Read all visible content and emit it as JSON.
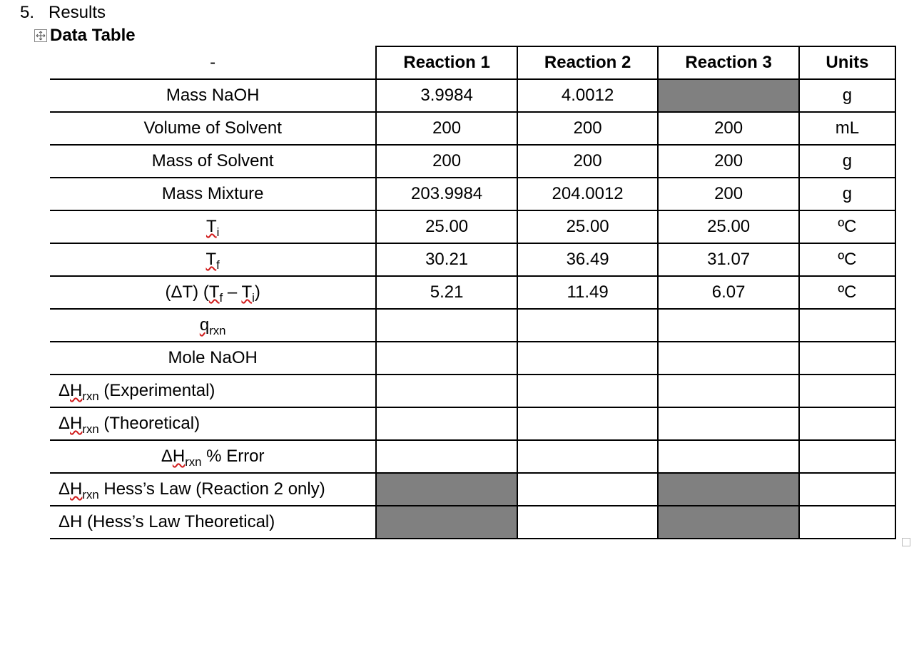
{
  "heading": {
    "list_number": "5.",
    "title": "Results",
    "subtitle": "Data Table"
  },
  "table": {
    "header": {
      "blank": "-",
      "c1": "Reaction 1",
      "c2": "Reaction 2",
      "c3": "Reaction 3",
      "units": "Units"
    },
    "rows": [
      {
        "label_html": "Mass NaOH",
        "align": "center",
        "r1": "3.9984",
        "r2": "4.0012",
        "r3": "",
        "r3_shaded": true,
        "units": "g"
      },
      {
        "label_html": "Volume of Solvent",
        "align": "center",
        "r1": "200",
        "r2": "200",
        "r3": "200",
        "units": "mL"
      },
      {
        "label_html": "Mass of Solvent",
        "align": "center",
        "r1": "200",
        "r2": "200",
        "r3": "200",
        "units": "g"
      },
      {
        "label_html": "Mass Mixture",
        "align": "center",
        "r1": "203.9984",
        "r2": "204.0012",
        "r3": "200",
        "units": "g"
      },
      {
        "label_html": "<span class=\"squiggle\">T<sub>i</sub></span>",
        "align": "center",
        "r1": "25.00",
        "r2": "25.00",
        "r3": "25.00",
        "units": "ºC"
      },
      {
        "label_html": "<span class=\"squiggle\">T<sub>f</sub></span>",
        "align": "center",
        "r1": "30.21",
        "r2": "36.49",
        "r3": "31.07",
        "units": "ºC"
      },
      {
        "label_html": "(ΔT) (<span class=\"squiggle\">T<sub>f</sub></span> – <span class=\"squiggle\">T<sub>i</sub></span>)",
        "align": "center",
        "r1": "5.21",
        "r2": "11.49",
        "r3": "6.07",
        "units": "ºC"
      },
      {
        "label_html": "<span class=\"squiggle\">q<sub>rxn</sub></span>",
        "align": "center",
        "r1": "",
        "r2": "",
        "r3": "",
        "units": ""
      },
      {
        "label_html": "Mole NaOH",
        "align": "center",
        "r1": "",
        "r2": "",
        "r3": "",
        "units": ""
      },
      {
        "label_html": "Δ<span class=\"squiggle\">H<sub>rxn</sub></span> (Experimental)",
        "align": "left",
        "r1": "",
        "r2": "",
        "r3": "",
        "units": ""
      },
      {
        "label_html": "Δ<span class=\"squiggle\">H<sub>rxn</sub></span> (Theoretical)",
        "align": "left",
        "r1": "",
        "r2": "",
        "r3": "",
        "units": ""
      },
      {
        "label_html": "Δ<span class=\"squiggle\">H<sub>rxn</sub></span> % Error",
        "align": "center",
        "r1": "",
        "r2": "",
        "r3": "",
        "units": ""
      },
      {
        "label_html": "Δ<span class=\"squiggle\">H<sub>rxn</sub></span> Hess’s Law (Reaction 2 only)",
        "align": "left",
        "r1": "",
        "r1_shaded": true,
        "r2": "",
        "r3": "",
        "r3_shaded": true,
        "units": ""
      },
      {
        "label_html": "ΔH (Hess’s Law Theoretical)",
        "align": "left",
        "r1": "",
        "r1_shaded": true,
        "r2": "",
        "r3": "",
        "r3_shaded": true,
        "units": ""
      }
    ]
  }
}
